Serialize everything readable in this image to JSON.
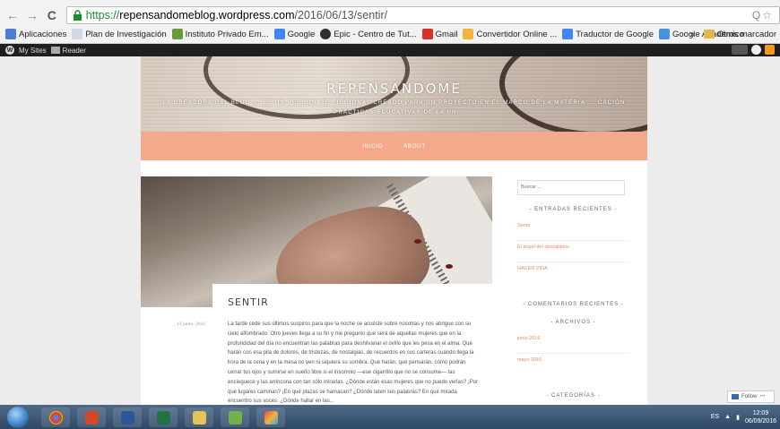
{
  "browser": {
    "url_secure": "https://",
    "url_host": "repensandomeblog.wordpress.com",
    "url_path": "/2016/06/13/sentir/",
    "bookmarks": [
      {
        "label": "Aplicaciones",
        "color": "#4a7fd4"
      },
      {
        "label": "Plan de Investigación",
        "color": "#cfd8e3"
      },
      {
        "label": "Instituto Privado Em...",
        "color": "#6a9a3a"
      },
      {
        "label": "Google",
        "color": "#4285f4"
      },
      {
        "label": "Epic - Centro de Tut...",
        "color": "#2f2f2f"
      },
      {
        "label": "Gmail",
        "color": "#d93025"
      },
      {
        "label": "Convertidor Online ...",
        "color": "#f2b43c"
      },
      {
        "label": "Traductor de Google",
        "color": "#4285f4"
      },
      {
        "label": "Google Académico",
        "color": "#4a90e2"
      }
    ],
    "more_label": "»",
    "other_bookmarks": "Otros marcador"
  },
  "adminbar": {
    "my_sites": "My Sites",
    "reader": "Reader"
  },
  "site": {
    "title": "REPENSANDOME",
    "description": "LA CREADORA DEL BLOG ... ES UN PERSONAJE FICCIONAL CREADO PARA UN PROYECTO EN EL MARCO DE LA MATERIA ... CACIÓN ... PRÁCTICAS EDUCATIVAS DE LA UN...",
    "menu": [
      "INICIO",
      "ABOUT"
    ]
  },
  "post": {
    "title": "SENTIR",
    "date": "13 junio, 2016",
    "body": "La tarde cede sus últimos suspiros para que la noche se acueste sobre nosotras y nos abrigue con su cielo alfombrado. Otro jueves llega a su fin y me pregunto qué será de aquellas mujeres que en la profundidad del día no encuentran las palabras para deshilvanar el ovillo que les pesa en el alma. Qué harán con esa pila de dolores, de tristezas, de nostalgias, de recuerdos en sus carteras cuando llega la hora de la cena y en la mesa no ven ni siquiera su sombra. Qué harán, qué pensarán, cómo podrán cerrar tus ojos y sumirse en sueño libre si el insomnio —ese cigarrillo que no se consume— las encieguece y las arrincona con tan sólo mirarlas. ¿Dónde están esas mujeres que no puedo verlas? ¡Por qué lugares caminan? ¡En qué plazas se hamacan? ¿Dónde laten sus palabras? En qué mirada encuentro sus voces. ¿Dónde hallar en las..."
  },
  "sidebar": {
    "search_placeholder": "Buscar ...",
    "recent_entries_title": "- ENTRADAS RECIENTES -",
    "recent_entries": [
      "Sentir",
      "El ángel del apocalipsis",
      "HACER VIDA"
    ],
    "recent_comments_title": "- COMENTARIOS RECIENTES -",
    "archives_title": "- ARCHIVOS -",
    "archives": [
      "junio 2016",
      "mayo 2016"
    ],
    "categories_title": "- CATEGORÍAS -"
  },
  "follow": {
    "label": "Follow",
    "more": "•••"
  },
  "taskbar": {
    "lang": "ES",
    "time": "12:09",
    "date": "06/09/2016"
  }
}
